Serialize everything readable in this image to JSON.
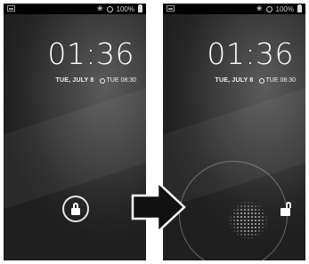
{
  "screens": [
    {
      "status": {
        "battery": "100%"
      },
      "lockscreen": {
        "time": "01:36",
        "date": "TUE, JULY 8",
        "alarm": "TUE 08:30"
      }
    },
    {
      "status": {
        "battery": "100%"
      },
      "lockscreen": {
        "time": "01:36",
        "date": "TUE, JULY 8",
        "alarm": "TUE 08:30"
      }
    }
  ],
  "icons": {
    "left_screen": [
      "notification-image-icon",
      "mute-icon",
      "alarm-icon",
      "battery-icon",
      "lock-icon"
    ],
    "right_screen": [
      "notification-image-icon",
      "mute-icon",
      "alarm-icon",
      "battery-icon",
      "unlock-icon"
    ],
    "transition": "arrow-right-icon"
  },
  "colors": {
    "screen_bg": "#2a2a2a",
    "text": "#ffffff",
    "arrow_fill": "#111111",
    "arrow_stroke": "#ffffff"
  }
}
